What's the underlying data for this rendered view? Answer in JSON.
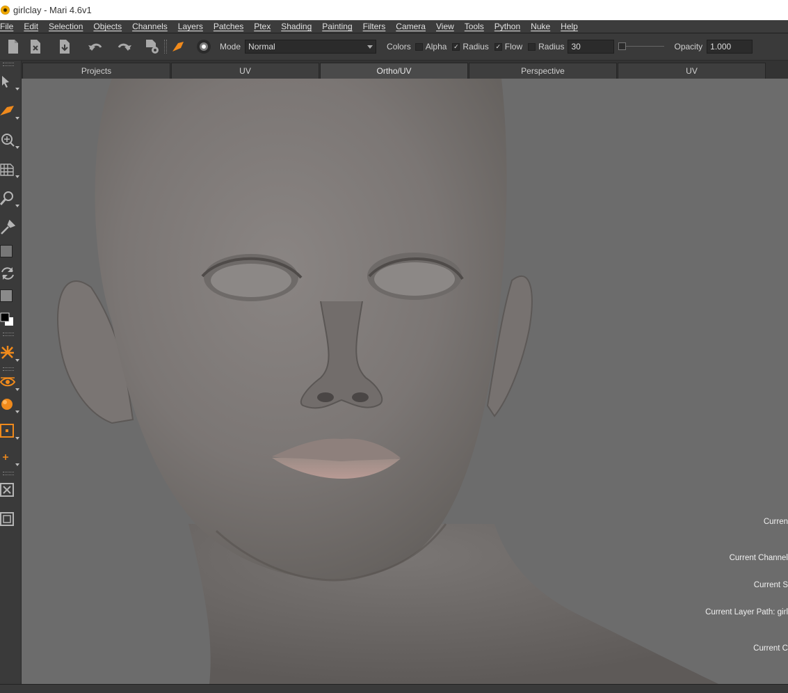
{
  "window": {
    "title": "girlclay - Mari 4.6v1"
  },
  "menu": [
    "File",
    "Edit",
    "Selection",
    "Objects",
    "Channels",
    "Layers",
    "Patches",
    "Ptex",
    "Shading",
    "Painting",
    "Filters",
    "Camera",
    "View",
    "Tools",
    "Python",
    "Nuke",
    "Help"
  ],
  "toolbar": {
    "mode_label": "Mode",
    "mode_value": "Normal",
    "colors_label": "Colors",
    "alpha_label": "Alpha",
    "alpha_checked": false,
    "radius_label": "Radius",
    "radius_checked": true,
    "flow_label": "Flow",
    "flow_checked": true,
    "radius2_label": "Radius",
    "radius2_checked": false,
    "radius_value": "30",
    "opacity_label": "Opacity",
    "opacity_value": "1.000",
    "check_glyph": "✓",
    "accent_color": "#f08a1c"
  },
  "tabs": [
    {
      "label": "Projects",
      "active": false
    },
    {
      "label": "UV",
      "active": false
    },
    {
      "label": "Ortho/UV",
      "active": true
    },
    {
      "label": "Perspective",
      "active": false
    },
    {
      "label": "UV",
      "active": false
    }
  ],
  "hud": {
    "line1": "Curren",
    "line2": "Current Channel",
    "line3": "Current S",
    "line4": "Current Layer Path: girl",
    "line5": "Current C"
  }
}
